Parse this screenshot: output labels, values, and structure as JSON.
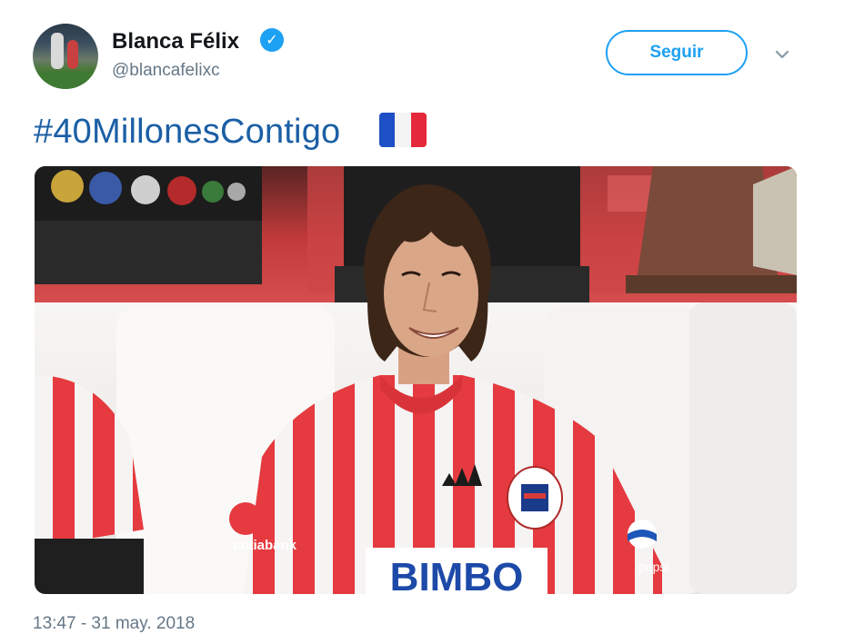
{
  "tweet": {
    "display_name": "Blanca Félix",
    "username": "@blancafelixc",
    "follow_label": "Seguir",
    "text": "#40MillonesContigo",
    "timestamp": "13:47 - 31 may. 2018",
    "media_text": {
      "sponsor_main": "BIMBO",
      "sponsor_sleeve": "cotiabank",
      "sponsor_right": "pepsi"
    }
  },
  "icons": {
    "verified": "verified-badge-icon",
    "caret": "chevron-down-icon",
    "flag": "france-flag-emoji"
  },
  "colors": {
    "accent": "#1da1f2",
    "hashtag": "#1b5fa5",
    "secondary_text": "#657786"
  }
}
